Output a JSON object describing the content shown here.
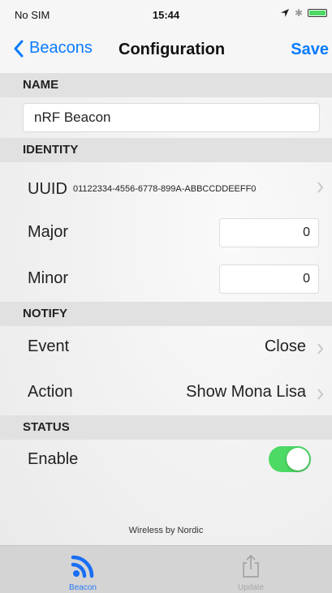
{
  "status_bar": {
    "carrier": "No SIM",
    "time": "15:44"
  },
  "nav": {
    "back_label": "Beacons",
    "title": "Configuration",
    "save_label": "Save"
  },
  "sections": {
    "name": "NAME",
    "identity": "IDENTITY",
    "notify": "NOTIFY",
    "status": "STATUS"
  },
  "name_field": {
    "value": "nRF Beacon"
  },
  "identity": {
    "uuid_label": "UUID",
    "uuid_value": "01122334-4556-6778-899A-ABBCCDDEEFF0",
    "major_label": "Major",
    "major_value": "0",
    "minor_label": "Minor",
    "minor_value": "0"
  },
  "notify": {
    "event_label": "Event",
    "event_value": "Close",
    "action_label": "Action",
    "action_value": "Show Mona Lisa"
  },
  "status": {
    "enable_label": "Enable",
    "enabled": true
  },
  "footer": "Wireless by Nordic",
  "tabs": [
    {
      "label": "Beacon",
      "icon": "beacon-icon",
      "selected": true
    },
    {
      "label": "Update",
      "icon": "share-icon",
      "selected": false
    }
  ],
  "colors": {
    "accent": "#0a7bff",
    "toggle_on": "#4cd964",
    "section_bg": "#e1e1e1"
  }
}
